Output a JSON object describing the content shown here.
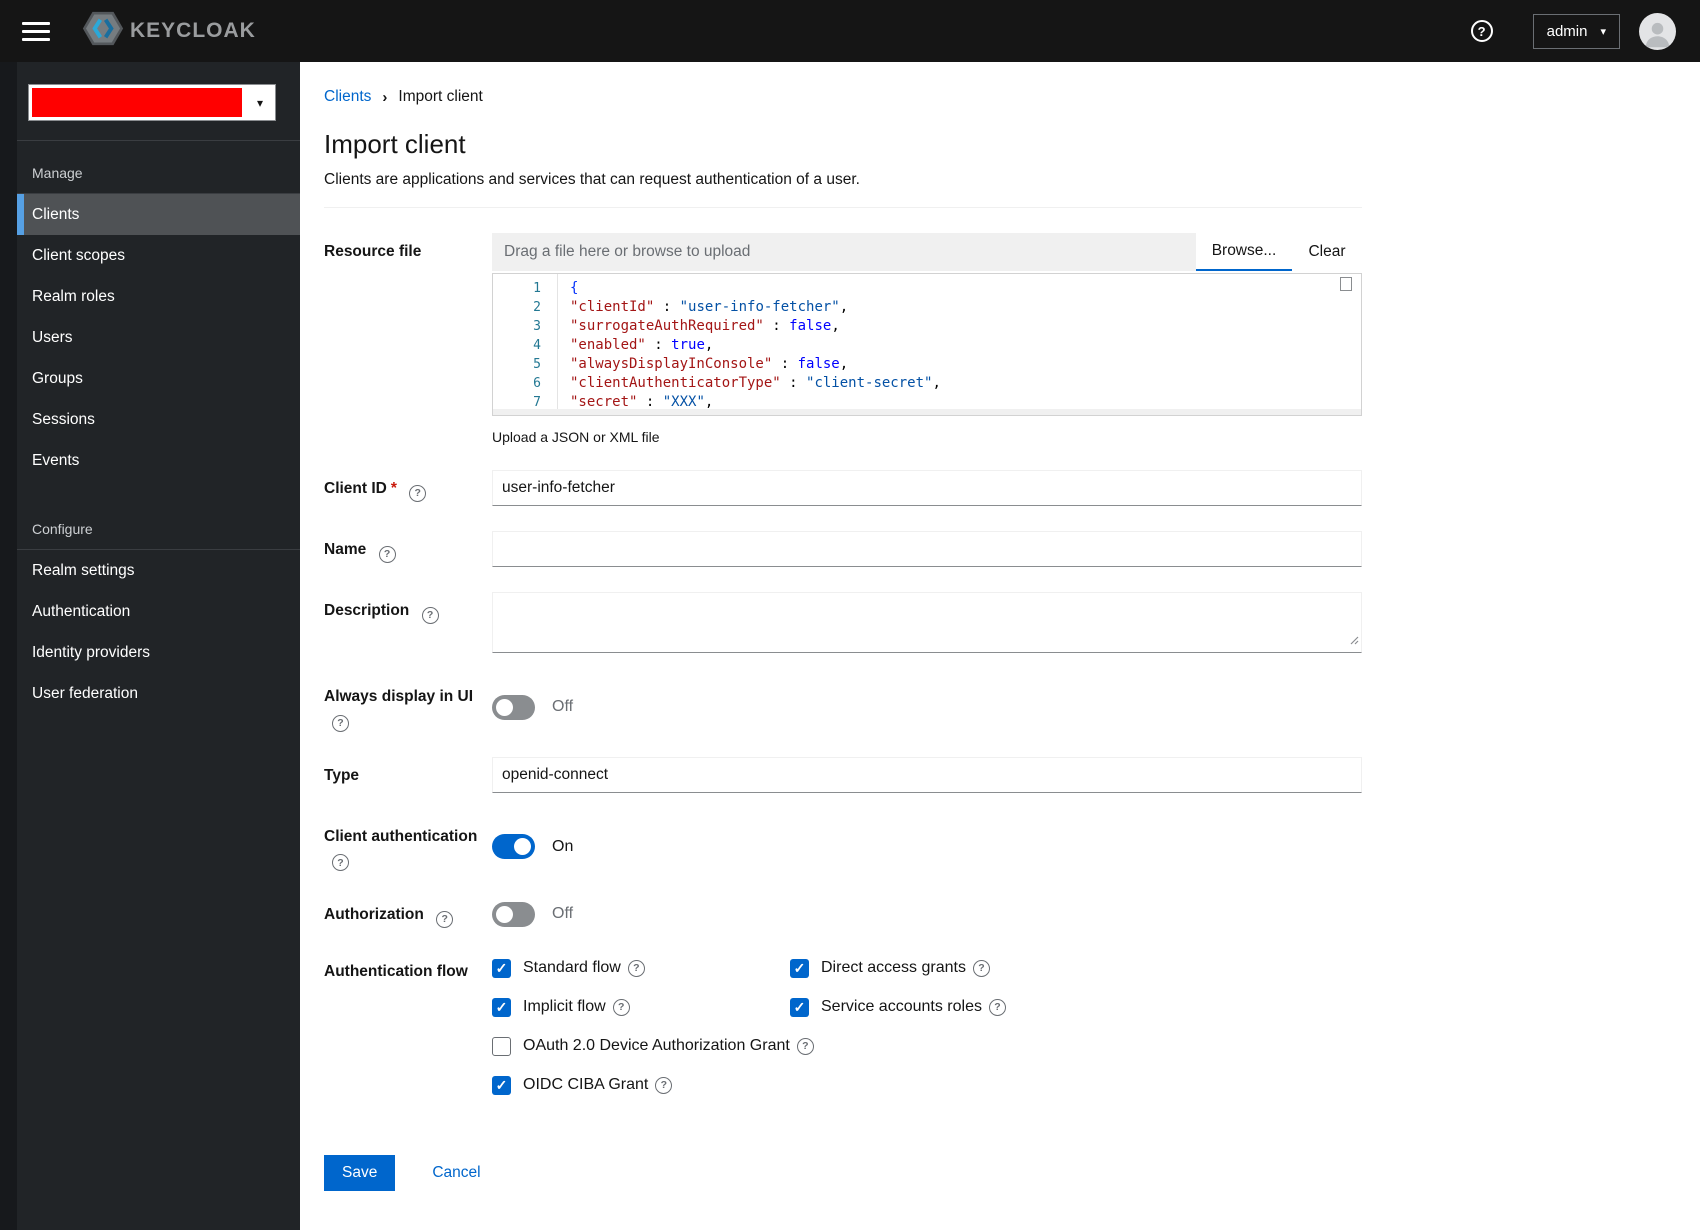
{
  "icons": {
    "help_glyph": "?",
    "caret_glyph": "▾",
    "breadcrumb_sep_glyph": "›",
    "check_glyph": "✓"
  },
  "colors": {
    "accent": "#0066cc",
    "nav_current_bar": "#56a0e4",
    "realm_redaction": "#ff0000",
    "required": "#c9190b"
  },
  "header": {
    "brand_text": "KEYCLOAK",
    "user_label": "admin"
  },
  "sidebar": {
    "groups": [
      {
        "label": "Manage",
        "items": [
          {
            "label": "Clients",
            "selected": true
          },
          {
            "label": "Client scopes"
          },
          {
            "label": "Realm roles"
          },
          {
            "label": "Users"
          },
          {
            "label": "Groups"
          },
          {
            "label": "Sessions"
          },
          {
            "label": "Events"
          }
        ]
      },
      {
        "label": "Configure",
        "items": [
          {
            "label": "Realm settings"
          },
          {
            "label": "Authentication"
          },
          {
            "label": "Identity providers"
          },
          {
            "label": "User federation"
          }
        ]
      }
    ]
  },
  "breadcrumb": {
    "parent": "Clients",
    "current": "Import client"
  },
  "page": {
    "title": "Import client",
    "subtitle": "Clients are applications and services that can request authentication of a user."
  },
  "form": {
    "resource_file": {
      "label": "Resource file",
      "placeholder": "Drag a file here or browse to upload",
      "browse_label": "Browse...",
      "clear_label": "Clear",
      "helper": "Upload a JSON or XML file"
    },
    "editor": {
      "token_colors": {
        "key": "#a31515",
        "str": "#0451a5",
        "bool": "#0000ff",
        "plain": "#000000",
        "brace": "#0431fa"
      },
      "lines": [
        {
          "n": "1",
          "tokens": [
            [
              "brace",
              "{"
            ]
          ]
        },
        {
          "n": "2",
          "tokens": [
            [
              "key",
              "\"clientId\""
            ],
            [
              "plain",
              " : "
            ],
            [
              "str",
              "\"user-info-fetcher\""
            ],
            [
              "plain",
              ","
            ]
          ]
        },
        {
          "n": "3",
          "tokens": [
            [
              "key",
              "\"surrogateAuthRequired\""
            ],
            [
              "plain",
              " : "
            ],
            [
              "bool",
              "false"
            ],
            [
              "plain",
              ","
            ]
          ]
        },
        {
          "n": "4",
          "tokens": [
            [
              "key",
              "\"enabled\""
            ],
            [
              "plain",
              " : "
            ],
            [
              "bool",
              "true"
            ],
            [
              "plain",
              ","
            ]
          ]
        },
        {
          "n": "5",
          "tokens": [
            [
              "key",
              "\"alwaysDisplayInConsole\""
            ],
            [
              "plain",
              " : "
            ],
            [
              "bool",
              "false"
            ],
            [
              "plain",
              ","
            ]
          ]
        },
        {
          "n": "6",
          "tokens": [
            [
              "key",
              "\"clientAuthenticatorType\""
            ],
            [
              "plain",
              " : "
            ],
            [
              "str",
              "\"client-secret\""
            ],
            [
              "plain",
              ","
            ]
          ]
        },
        {
          "n": "7",
          "tokens": [
            [
              "key",
              "\"secret\""
            ],
            [
              "plain",
              " : "
            ],
            [
              "str",
              "\"XXX\""
            ],
            [
              "plain",
              ","
            ]
          ]
        }
      ]
    },
    "client_id": {
      "label": "Client ID",
      "required_marker": "*",
      "value": "user-info-fetcher"
    },
    "name": {
      "label": "Name",
      "value": ""
    },
    "description": {
      "label": "Description",
      "value": ""
    },
    "always_display": {
      "label": "Always display in UI",
      "state": "Off"
    },
    "type": {
      "label": "Type",
      "value": "openid-connect"
    },
    "client_auth": {
      "label": "Client authentication",
      "state": "On"
    },
    "authorization": {
      "label": "Authorization",
      "state": "Off"
    },
    "auth_flow": {
      "label": "Authentication flow",
      "options": [
        {
          "label": "Standard flow",
          "checked": true,
          "full": false
        },
        {
          "label": "Direct access grants",
          "checked": true,
          "full": false
        },
        {
          "label": "Implicit flow",
          "checked": true,
          "full": false
        },
        {
          "label": "Service accounts roles",
          "checked": true,
          "full": false
        },
        {
          "label": "OAuth 2.0 Device Authorization Grant",
          "checked": false,
          "full": true
        },
        {
          "label": "OIDC CIBA Grant",
          "checked": true,
          "full": true
        }
      ]
    },
    "actions": {
      "save_label": "Save",
      "cancel_label": "Cancel"
    }
  }
}
